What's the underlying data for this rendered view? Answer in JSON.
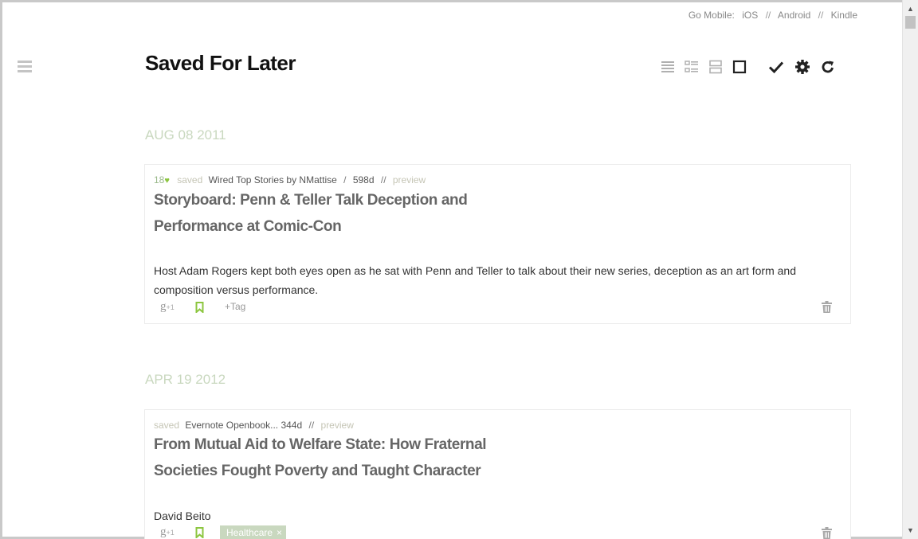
{
  "header": {
    "mobile_label": "Go Mobile:",
    "links": [
      "iOS",
      "Android",
      "Kindle"
    ],
    "separator": "//"
  },
  "page": {
    "title": "Saved For Later"
  },
  "toolbar": {
    "icons": [
      "list-view-icon",
      "detail-list-icon",
      "card-view-icon",
      "single-view-icon",
      "check-icon",
      "gear-icon",
      "refresh-icon"
    ]
  },
  "groups": [
    {
      "date": "AUG 08 2011",
      "item": {
        "count": "18",
        "saved_label": "saved",
        "source": "Wired Top Stories by NMattise",
        "age": "598d",
        "preview_label": "preview",
        "title_line1": "Storyboard: Penn & Teller Talk Deception and",
        "title_line2": "Performance at Comic-Con",
        "description": "Host Adam Rogers kept both eyes open as he sat with Penn and Teller to talk about their new series, deception as an art form and composition versus performance.",
        "gplus": "g",
        "gplus_count": "+1",
        "tag_label": "+Tag"
      }
    },
    {
      "date": "APR 19 2012",
      "item": {
        "saved_label": "saved",
        "source": "Evernote Openbook... 344d",
        "preview_label": "preview",
        "title_line1": "From Mutual Aid to Welfare State: How Fraternal",
        "title_line2": "Societies Fought Poverty and Taught Character",
        "description": "David Beito",
        "gplus": "g",
        "gplus_count": "+1",
        "tag": "Healthcare",
        "tag_remove": "×"
      }
    }
  ],
  "colors": {
    "accent_green": "#8cc63f",
    "date_color": "#c9d8bf",
    "tag_bg": "#c9d8bf"
  }
}
